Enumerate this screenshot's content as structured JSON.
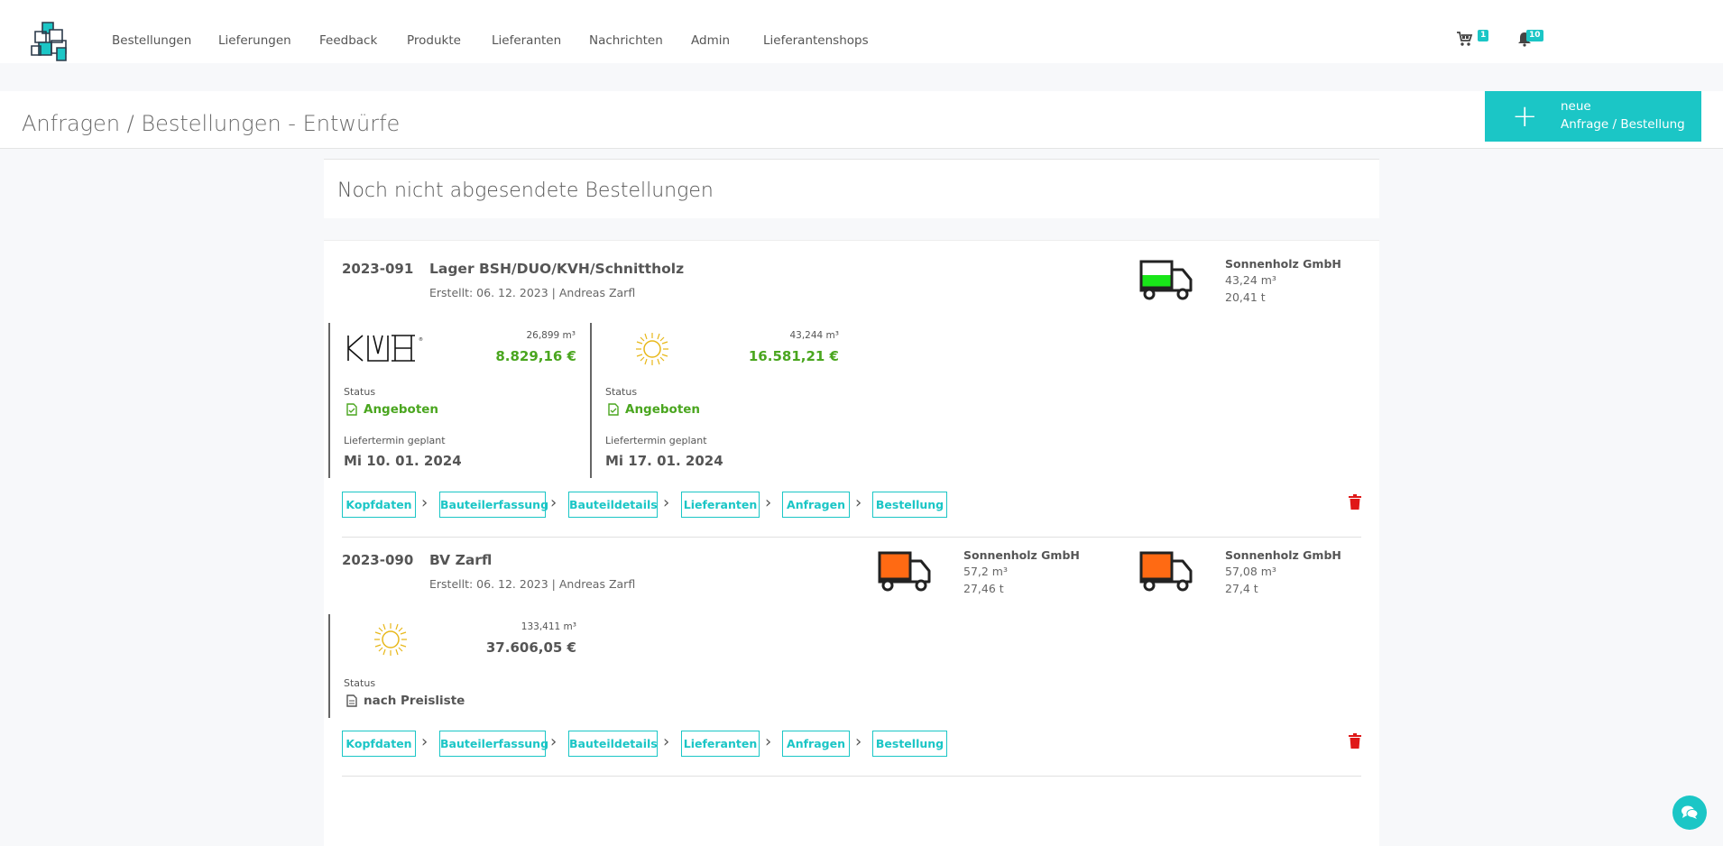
{
  "nav": {
    "items": [
      "Bestellungen",
      "Lieferungen",
      "Feedback",
      "Produkte",
      "Lieferanten",
      "Nachrichten",
      "Admin",
      "Lieferantenshops"
    ],
    "cart_badge": "1",
    "bell_badge": "10"
  },
  "page": {
    "title": "Anfragen / Bestellungen - Entwürfe",
    "new_button": {
      "line1": "neue",
      "line2": "Anfrage / Bestellung"
    },
    "section_title": "Noch nicht abgesendete Bestellungen"
  },
  "colors": {
    "accent": "#1bc6c6",
    "green": "#4aa61f",
    "truck_green": "#19e619",
    "truck_orange": "#ff6a13",
    "trash": "#e01818"
  },
  "orders": [
    {
      "number": "2023-091",
      "name": "Lager BSH/DUO/KVH/Schnittholz",
      "created": "Erstellt: 06. 12. 2023 | Andreas Zarfl",
      "trucks": [
        {
          "supplier": "Sonnenholz GmbH",
          "volume": "43,24 m³",
          "weight": "20,41 t",
          "color": "green",
          "fill_fraction": 0.55
        }
      ],
      "offers": [
        {
          "logo": "kvh-logo",
          "logo_text": "KVH",
          "quantity": "26,899 m³",
          "price": "8.829,16 €",
          "status_label": "Status",
          "status": "Angeboten",
          "date_label": "Liefertermin geplant",
          "date": "Mi 10. 01. 2024"
        },
        {
          "logo": "sun-logo",
          "quantity": "43,244 m³",
          "price": "16.581,21 €",
          "status_label": "Status",
          "status": "Angeboten",
          "date_label": "Liefertermin geplant",
          "date": "Mi 17. 01. 2024"
        }
      ],
      "steps": [
        "Kopfdaten",
        "Bauteilerfassung",
        "Bauteildetails",
        "Lieferanten",
        "Anfragen",
        "Bestellung"
      ]
    },
    {
      "number": "2023-090",
      "name": "BV Zarfl",
      "created": "Erstellt: 06. 12. 2023 | Andreas Zarfl",
      "trucks": [
        {
          "supplier": "Sonnenholz GmbH",
          "volume": "57,2 m³",
          "weight": "27,46 t",
          "color": "orange",
          "fill_fraction": 1
        },
        {
          "supplier": "Sonnenholz GmbH",
          "volume": "57,08 m³",
          "weight": "27,4 t",
          "color": "orange",
          "fill_fraction": 1
        }
      ],
      "offers": [
        {
          "logo": "sun-logo",
          "quantity": "133,411 m³",
          "price": "37.606,05 €",
          "status_label": "Status",
          "status": "nach Preisliste"
        }
      ],
      "steps": [
        "Kopfdaten",
        "Bauteilerfassung",
        "Bauteildetails",
        "Lieferanten",
        "Anfragen",
        "Bestellung"
      ]
    }
  ]
}
